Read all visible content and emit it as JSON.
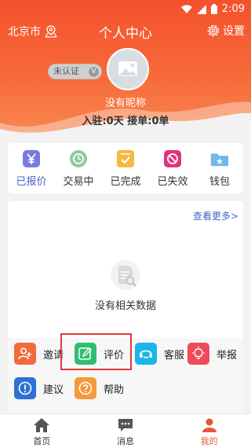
{
  "status_bar": {
    "time": "2:09"
  },
  "header": {
    "city": "北京市",
    "title": "个人中心",
    "settings_label": "设置"
  },
  "profile": {
    "cert_label": "未认证",
    "cert_mark": "V",
    "nickname": "没有昵称",
    "stats": "入驻:0天   接单:0单"
  },
  "orders": [
    {
      "label": "已报价",
      "icon": "yen-icon",
      "color": "#7b79e0"
    },
    {
      "label": "交易中",
      "icon": "trade-icon",
      "color": "#8fc9a0"
    },
    {
      "label": "已完成",
      "icon": "completed-icon",
      "color": "#f5b942"
    },
    {
      "label": "已失效",
      "icon": "invalid-icon",
      "color": "#e0337d"
    },
    {
      "label": "钱包",
      "icon": "wallet-icon",
      "color": "#6fb8ea"
    }
  ],
  "records": {
    "see_more": "查看更多>",
    "empty_text": "没有相关数据"
  },
  "functions": [
    {
      "label": "邀请",
      "icon": "invite-icon",
      "color": "#f26a3c"
    },
    {
      "label": "评价",
      "icon": "review-icon",
      "color": "#2fbf71"
    },
    {
      "label": "客服",
      "icon": "headset-icon",
      "color": "#1bb5e8"
    },
    {
      "label": "举报",
      "icon": "report-icon",
      "color": "#ef4a57"
    },
    {
      "label": "建议",
      "icon": "suggestion-icon",
      "color": "#2f6fd6"
    },
    {
      "label": "帮助",
      "icon": "help-icon",
      "color": "#f59a3c"
    }
  ],
  "tabs": [
    {
      "label": "首页",
      "icon": "home-icon"
    },
    {
      "label": "消息",
      "icon": "message-icon"
    },
    {
      "label": "我的",
      "icon": "person-icon"
    }
  ],
  "colors": {
    "accent": "#f4512c",
    "link": "#4a62c8",
    "highlight": "#e53935",
    "active_tab": "#e8553a"
  }
}
